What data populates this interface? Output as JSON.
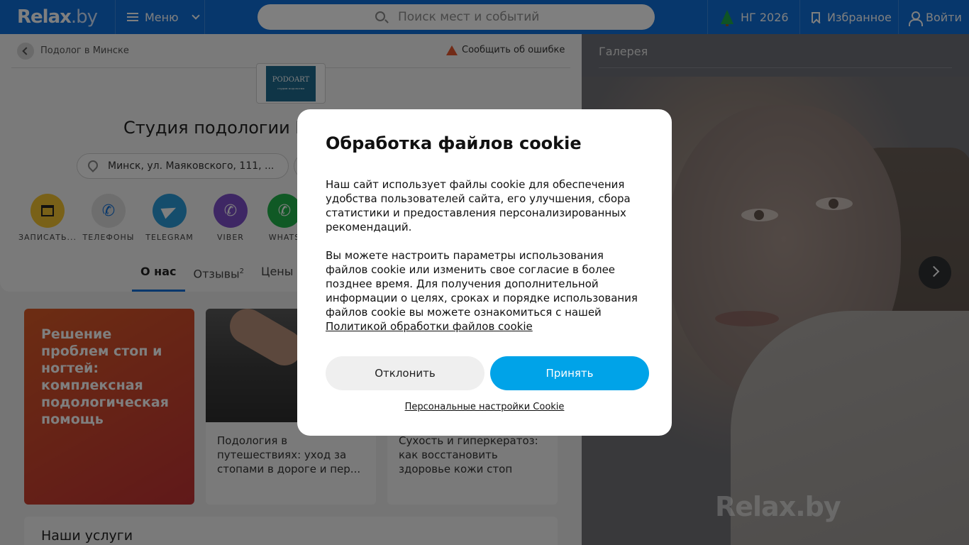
{
  "header": {
    "logo_main": "Relax",
    "logo_tld": ".by",
    "menu_label": "Меню",
    "search_placeholder": "Поиск мест и событий",
    "ng_label": "НГ 2026",
    "favorites_label": "Избранное",
    "login_label": "Войти"
  },
  "breadcrumb": {
    "back_label": "Подолог в Минске",
    "report_label": "Сообщить об ошибке"
  },
  "place": {
    "logo_text": "PODOART",
    "logo_sub": "студия подологии",
    "title": "Студия подологии P",
    "address": "Минск, ул. Маяковского, 111, ..."
  },
  "actions": [
    {
      "label": "ЗАПИСАТЬ...",
      "color": "#f2c230"
    },
    {
      "label": "ТЕЛЕФОНЫ",
      "color": "#dcdcdc"
    },
    {
      "label": "TELEGRAM",
      "color": "#2a9ad8"
    },
    {
      "label": "VIBER",
      "color": "#7d4fc9"
    },
    {
      "label": "WHATS",
      "color": "#21b34a"
    }
  ],
  "tabs": [
    {
      "label": "О нас",
      "sup": ""
    },
    {
      "label": "Отзывы",
      "sup": "2"
    },
    {
      "label": "Цены",
      "sup": ""
    }
  ],
  "promo": {
    "text": "Решение проблем стоп и ногтей: комплексная подологическая помощь"
  },
  "articles": [
    {
      "text": "Подология в путешествиях: уход за стопами в дороге и пер..."
    },
    {
      "text": "Сухость и гиперкератоз: как восстановить здоровье кожи стоп"
    }
  ],
  "services": {
    "title": "Наши услуги"
  },
  "gallery": {
    "title": "Галерея",
    "watermark": "Relax.by"
  },
  "cookie": {
    "title": "Обработка файлов cookie",
    "paragraph1": "Наш сайт использует файлы cookie для обеспечения удобства пользователей сайта, его улучшения, сбора статистики и предоставления персонализированных рекомендаций.",
    "paragraph2": "Вы можете настроить параметры использования файлов cookie или изменить свое согласие в более позднее время. Для получения дополнительной информации о целях, сроках и порядке использования файлов cookie вы можете ознакомиться с нашей",
    "policy_link": "Политикой обработки файлов cookie",
    "decline_label": "Отклонить",
    "accept_label": "Принять",
    "settings_label": "Персональные настройки Cookie"
  }
}
